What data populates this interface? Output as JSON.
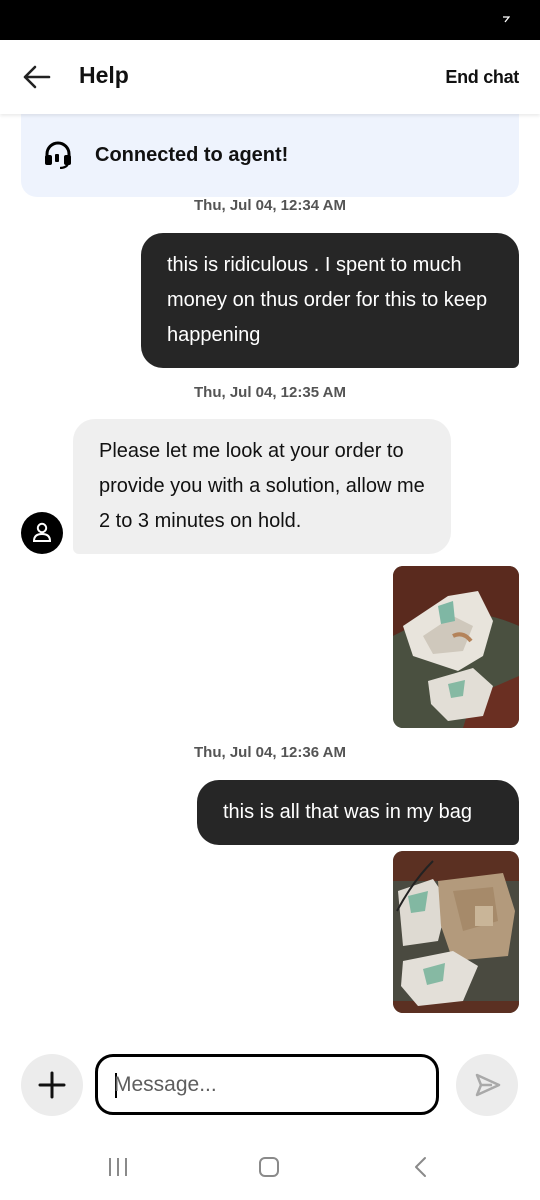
{
  "header": {
    "title": "Help",
    "end_chat_label": "End chat"
  },
  "banner": {
    "text": "Connected to agent!",
    "icon": "headset-icon"
  },
  "messages": [
    {
      "type": "timestamp",
      "text": "Thu, Jul 04, 12:34 AM"
    },
    {
      "type": "outgoing",
      "text": "this is ridiculous . I spent to much money on thus order for this to keep happening"
    },
    {
      "type": "timestamp",
      "text": "Thu, Jul 04, 12:35 AM"
    },
    {
      "type": "incoming",
      "text": "Please let me look at your order to provide you with a solution, allow me 2 to 3 minutes on hold."
    },
    {
      "type": "outgoing-image",
      "content": "photo of crumpled food wrappers on a couch"
    },
    {
      "type": "timestamp",
      "text": "Thu, Jul 04, 12:36 AM"
    },
    {
      "type": "outgoing",
      "text": "this is all that was in my bag"
    },
    {
      "type": "outgoing-image",
      "content": "photo of paper bag with crumpled wrappers"
    }
  ],
  "composer": {
    "placeholder": "Message...",
    "add_icon": "plus-icon",
    "send_icon": "send-icon"
  },
  "colors": {
    "outgoing_bubble": "#262626",
    "incoming_bubble": "#efefef",
    "banner_bg": "#eef3fd"
  },
  "nav": {
    "icons": [
      "recent-apps-icon",
      "home-icon",
      "back-nav-icon"
    ]
  }
}
